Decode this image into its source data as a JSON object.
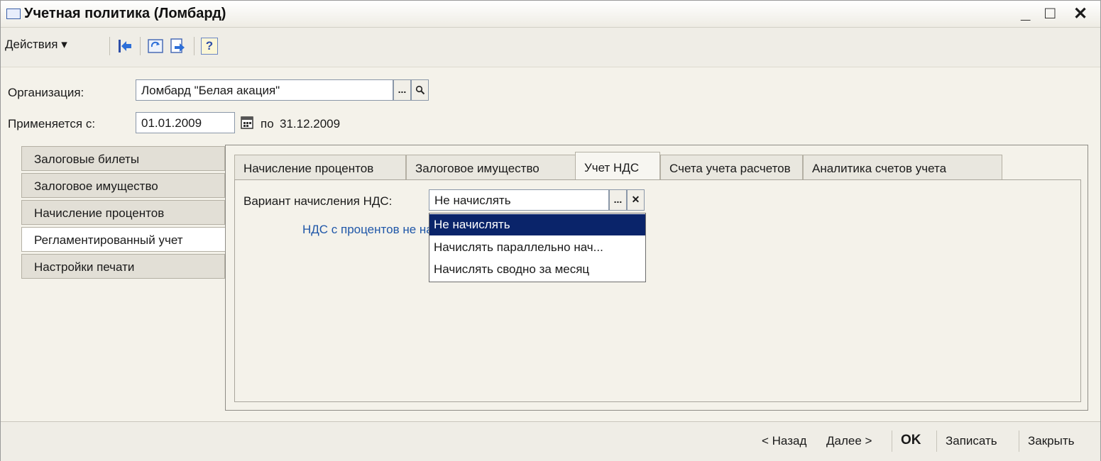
{
  "window": {
    "title": "Учетная политика (Ломбард)",
    "controls": {
      "minimize": "_",
      "maximize": "□",
      "close": "✕"
    }
  },
  "toolbar": {
    "actions_label": "Действия ▾",
    "help_label": "?"
  },
  "form": {
    "organization_label": "Организация:",
    "organization_value": "Ломбард \"Белая акация\"",
    "select_button": "...",
    "applies_label": "Применяется с:",
    "applies_from": "01.01.2009",
    "applies_to_label": "по",
    "applies_to": "31.12.2009"
  },
  "left_tabs": [
    {
      "label": "Залоговые билеты",
      "active": false
    },
    {
      "label": "Залоговое имущество",
      "active": false
    },
    {
      "label": "Начисление процентов",
      "active": false
    },
    {
      "label": "Регламентированный учет",
      "active": true
    },
    {
      "label": "Настройки печати",
      "active": false
    }
  ],
  "inner_tabs": [
    {
      "label": "Начисление процентов",
      "active": false
    },
    {
      "label": "Залоговое имущество",
      "active": false
    },
    {
      "label": "Учет НДС",
      "active": true
    },
    {
      "label": "Счета учета расчетов",
      "active": false
    },
    {
      "label": "Аналитика счетов учета",
      "active": false
    }
  ],
  "vat": {
    "label": "Вариант начисления НДС:",
    "value": "Не начислять",
    "select_button": "...",
    "clear_button": "✕",
    "note": "НДС с процентов не начисляется"
  },
  "dropdown": {
    "options": [
      {
        "label": "Не начислять",
        "selected": true
      },
      {
        "label": "Начислять параллельно нач...",
        "selected": false
      },
      {
        "label": "Начислять сводно за месяц",
        "selected": false
      }
    ]
  },
  "footer": {
    "back": "< Назад",
    "next": "Далее >",
    "ok": "OK",
    "save": "Записать",
    "close": "Закрыть"
  },
  "colors": {
    "selection": "#0a246a",
    "link": "#1f57a8",
    "window_bg": "#f4f2ea"
  }
}
